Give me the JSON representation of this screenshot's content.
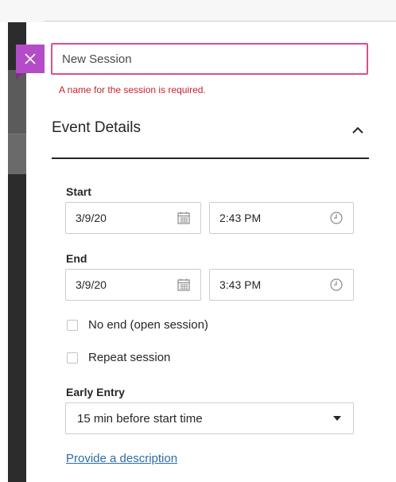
{
  "session": {
    "name_value": "",
    "name_placeholder": "New Session",
    "name_error": "A name for the session is required."
  },
  "event_details": {
    "title": "Event Details",
    "start": {
      "label": "Start",
      "date": "3/9/20",
      "time": "2:43 PM"
    },
    "end": {
      "label": "End",
      "date": "3/9/20",
      "time": "3:43 PM"
    },
    "no_end_label": "No end (open session)",
    "repeat_label": "Repeat session",
    "early_entry": {
      "label": "Early Entry",
      "selected": "15 min before start time"
    },
    "description_link": "Provide a description"
  },
  "icons": {
    "close": "close-icon",
    "collapse": "chevron-up-icon",
    "calendar": "calendar-icon",
    "clock": "clock-icon",
    "dropdown": "caret-down-icon"
  },
  "colors": {
    "accent": "#b44cc8",
    "input_error_border": "#d9508f",
    "error_text": "#c81f2f",
    "link": "#2e6ca8"
  }
}
